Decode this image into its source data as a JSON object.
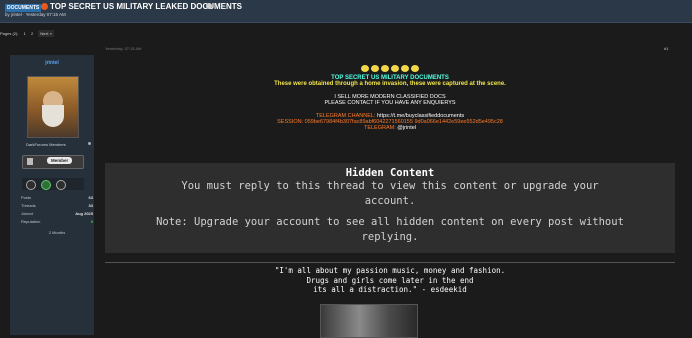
{
  "thread": {
    "prefix": "DOCUMENTS",
    "title": "TOP SECRET US MILITARY LEAKED DOCUMENTS",
    "byline": "by jrintel · Yesterday 07:15 AM"
  },
  "pagination": {
    "label": "Pages (2):",
    "pages": [
      "1",
      "2"
    ],
    "next": "Next »"
  },
  "post": {
    "date": "Yesterday, 07:15 AM",
    "number": "#1"
  },
  "user": {
    "name": "jrintel",
    "title": "DarkForums Members",
    "rank_label": "Member",
    "stats": [
      {
        "k": "Posts",
        "v": "63"
      },
      {
        "k": "Threads",
        "v": "33"
      },
      {
        "k": "Joined",
        "v": "Aug 2025"
      },
      {
        "k": "Reputation",
        "v": "0"
      }
    ],
    "time_online": "2 Months"
  },
  "content": {
    "headline": "TOP SECRET US MILITARY DOCUMENTS",
    "subline": "These were obtained through a home invasion, these were captured at the scene.",
    "sell1": "I SELL MORE MODERN CLASSIFIED DOCS",
    "sell2": "PLEASE CONTACT IF YOU HAVE ANY ENQUIERYS",
    "tg_channel_label": "TELEGRAM CHANNEL:",
    "tg_channel_value": "https://t.me/buyclassifieddocuments",
    "session_label": "SESSION: 059be67984f4b307fac89abf6042271560155 9d0a066e1442e59ee552d5e495c28",
    "telegram_label": "TELEGRAM:",
    "telegram_value": "@jrintel"
  },
  "hidden": {
    "title": "Hidden Content",
    "msg1": "You must reply to this thread to view this content or upgrade your",
    "msg2": "account.",
    "note1": "Note: Upgrade your account to see all hidden content on every post without",
    "note2": "replying."
  },
  "signature": {
    "line1": "\"I'm all about my passion music, money and fashion.",
    "line2": "Drugs and girls come later in the end",
    "line3": "its all a distraction.\" - esdeekid"
  },
  "colors": {
    "headline": "#52ffe6",
    "subline": "#f1e54a",
    "orange": "#ff7a29",
    "username": "#5aa2f0"
  }
}
